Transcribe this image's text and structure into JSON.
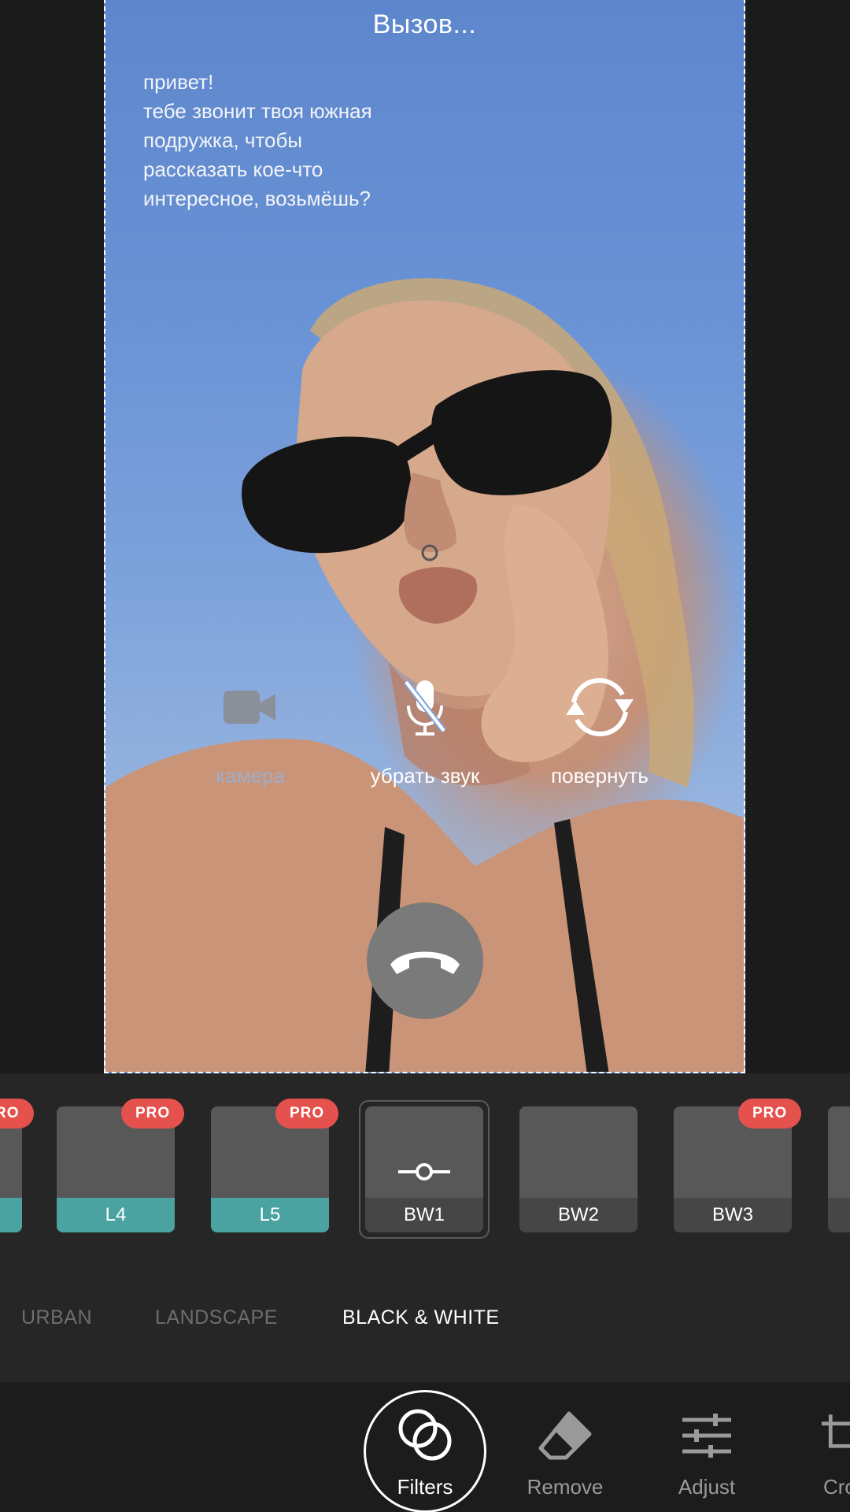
{
  "call": {
    "title": "Вызов...",
    "message": "привет!\nтебе звонит твоя южная\nподружка, чтобы\nрассказать кое-что\nинтересное, возьмёшь?",
    "actions": {
      "camera": "камера",
      "mute": "убрать звук",
      "rotate": "повернуть"
    }
  },
  "filters": {
    "items": [
      {
        "label": "",
        "pro": true,
        "pro_label": "RO",
        "teal": true
      },
      {
        "label": "L4",
        "pro": true,
        "pro_label": "PRO",
        "teal": true
      },
      {
        "label": "L5",
        "pro": true,
        "pro_label": "PRO",
        "teal": true
      },
      {
        "label": "BW1",
        "pro": false,
        "selected": true
      },
      {
        "label": "BW2",
        "pro": false
      },
      {
        "label": "BW3",
        "pro": true,
        "pro_label": "PRO"
      },
      {
        "label": "",
        "pro": false
      }
    ],
    "categories": [
      {
        "label": "URBAN",
        "active": false
      },
      {
        "label": "LANDSCAPE",
        "active": false
      },
      {
        "label": "BLACK & WHITE",
        "active": true
      }
    ]
  },
  "toolbar": {
    "filters": "Filters",
    "remove": "Remove",
    "adjust": "Adjust",
    "crop": "Cro"
  },
  "colors": {
    "accent_pro": "#e5524d",
    "teal": "#4aa3a0",
    "panel": "#262626",
    "toolbar": "#1c1c1c"
  }
}
